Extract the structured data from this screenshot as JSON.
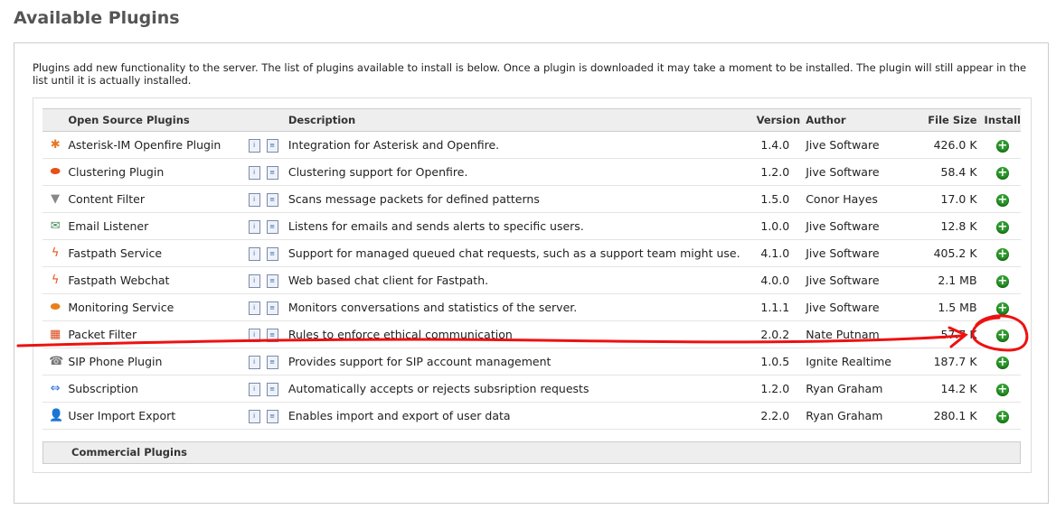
{
  "title": "Available Plugins",
  "intro": "Plugins add new functionality to the server. The list of plugins available to install is below. Once a plugin is downloaded it may take a moment to be installed. The plugin will still appear in the list until it is actually installed.",
  "table": {
    "headers": {
      "name": "Open Source Plugins",
      "description": "Description",
      "version": "Version",
      "author": "Author",
      "size": "File Size",
      "install": "Install"
    },
    "rows": [
      {
        "icon": "asterisk-icon",
        "glyph": "✱",
        "color": "#e87722",
        "name": "Asterisk-IM Openfire Plugin",
        "description": "Integration for Asterisk and Openfire.",
        "version": "1.4.0",
        "author": "Jive Software",
        "size": "426.0 K"
      },
      {
        "icon": "clustering-icon",
        "glyph": "⬬",
        "color": "#e8501a",
        "name": "Clustering Plugin",
        "description": "Clustering support for Openfire.",
        "version": "1.2.0",
        "author": "Jive Software",
        "size": "58.4 K"
      },
      {
        "icon": "funnel-icon",
        "glyph": "▼",
        "color": "#888",
        "name": "Content Filter",
        "description": "Scans message packets for defined patterns",
        "version": "1.5.0",
        "author": "Conor Hayes",
        "size": "17.0 K"
      },
      {
        "icon": "email-icon",
        "glyph": "✉",
        "color": "#4a8a5a",
        "name": "Email Listener",
        "description": "Listens for emails and sends alerts to specific users.",
        "version": "1.0.0",
        "author": "Jive Software",
        "size": "12.8 K"
      },
      {
        "icon": "fastpath-icon",
        "glyph": "ϟ",
        "color": "#e8501a",
        "name": "Fastpath Service",
        "description": "Support for managed queued chat requests, such as a support team might use.",
        "version": "4.1.0",
        "author": "Jive Software",
        "size": "405.2 K"
      },
      {
        "icon": "fastpath-icon",
        "glyph": "ϟ",
        "color": "#e8501a",
        "name": "Fastpath Webchat",
        "description": "Web based chat client for Fastpath.",
        "version": "4.0.0",
        "author": "Jive Software",
        "size": "2.1 MB"
      },
      {
        "icon": "monitoring-icon",
        "glyph": "⬬",
        "color": "#e8801a",
        "name": "Monitoring Service",
        "description": "Monitors conversations and statistics of the server.",
        "version": "1.1.1",
        "author": "Jive Software",
        "size": "1.5 MB"
      },
      {
        "icon": "firewall-icon",
        "glyph": "▦",
        "color": "#d84a1a",
        "name": "Packet Filter",
        "description": "Rules to enforce ethical communication",
        "version": "2.0.2",
        "author": "Nate Putnam",
        "size": "57.7 K"
      },
      {
        "icon": "phone-icon",
        "glyph": "☎",
        "color": "#777",
        "name": "SIP Phone Plugin",
        "description": "Provides support for SIP account management",
        "version": "1.0.5",
        "author": "Ignite Realtime",
        "size": "187.7 K"
      },
      {
        "icon": "arrows-icon",
        "glyph": "⇔",
        "color": "#2a6ad8",
        "name": "Subscription",
        "description": "Automatically accepts or rejects subsription requests",
        "version": "1.2.0",
        "author": "Ryan Graham",
        "size": "14.2 K"
      },
      {
        "icon": "user-import-icon",
        "glyph": "👤",
        "color": "#c87a2a",
        "name": "User Import Export",
        "description": "Enables import and export of user data",
        "version": "2.2.0",
        "author": "Ryan Graham",
        "size": "280.1 K"
      }
    ]
  },
  "commercial": "Commercial Plugins",
  "annotation_color": "#ee1111"
}
